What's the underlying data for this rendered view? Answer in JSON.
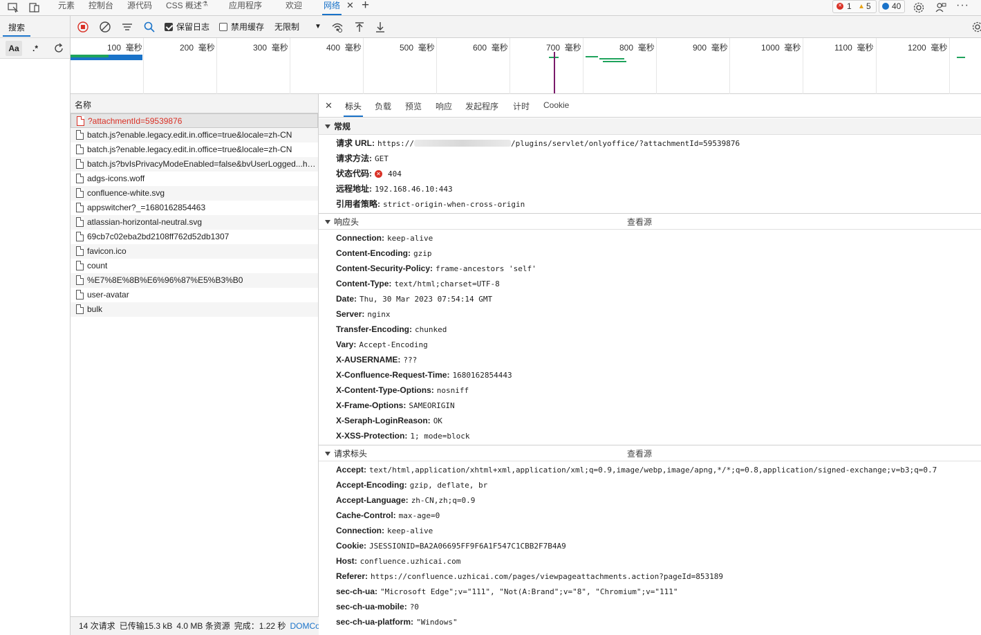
{
  "topbar": {
    "tabs": [
      "元素",
      "控制台",
      "源代码",
      "CSS 概述",
      "应用程序",
      "欢迎",
      "网络"
    ],
    "active_tab": "网络",
    "errors": "1",
    "warnings": "5",
    "messages": "40"
  },
  "left_pane": {
    "search_tab": "搜索",
    "match_case": "Aa",
    "regex": ".*"
  },
  "toolbar": {
    "preserve_log": "保留日志",
    "disable_cache": "禁用缓存",
    "throttle": "无限制"
  },
  "overview": {
    "unit": "毫秒",
    "ticks": [
      "100",
      "200",
      "300",
      "400",
      "500",
      "600",
      "700",
      "800",
      "900",
      "1000",
      "1100",
      "1200"
    ]
  },
  "request_list": {
    "header": "名称",
    "rows": [
      "?attachmentId=59539876",
      "batch.js?enable.legacy.edit.in.office=true&locale=zh-CN",
      "batch.js?enable.legacy.edit.in.office=true&locale=zh-CN",
      "batch.js?bvIsPrivacyModeEnabled=false&bvUserLogged...ho...",
      "adgs-icons.woff",
      "confluence-white.svg",
      "appswitcher?_=1680162854463",
      "atlassian-horizontal-neutral.svg",
      "69cb7c02eba2bd2108ff762d52db1307",
      "favicon.ico",
      "count",
      "%E7%8E%8B%E6%96%87%E5%B3%B0",
      "user-avatar",
      "bulk"
    ]
  },
  "status_bar": {
    "requests": "14 次请求",
    "transferred": "已传输15.3 kB",
    "resources": "4.0 MB 条资源",
    "finish": "完成：1.22 秒",
    "domcontent": "DOMCo"
  },
  "details": {
    "tabs": [
      "标头",
      "负载",
      "预览",
      "响应",
      "发起程序",
      "计时",
      "Cookie"
    ],
    "active_tab": "标头",
    "view_source": "查看源",
    "general": {
      "title": "常规",
      "url_label": "请求 URL:",
      "url_prefix": "https://",
      "url_suffix": "/plugins/servlet/onlyoffice/?attachmentId=59539876",
      "method_label": "请求方法:",
      "method": "GET",
      "status_label": "状态代码:",
      "status": "404",
      "remote_label": "远程地址:",
      "remote": "192.168.46.10:443",
      "referrer_label": "引用者策略:",
      "referrer": "strict-origin-when-cross-origin"
    },
    "response_headers": {
      "title": "响应头",
      "items": [
        {
          "k": "Connection:",
          "v": "keep-alive"
        },
        {
          "k": "Content-Encoding:",
          "v": "gzip"
        },
        {
          "k": "Content-Security-Policy:",
          "v": "frame-ancestors 'self'"
        },
        {
          "k": "Content-Type:",
          "v": "text/html;charset=UTF-8"
        },
        {
          "k": "Date:",
          "v": "Thu, 30 Mar 2023 07:54:14 GMT"
        },
        {
          "k": "Server:",
          "v": "nginx"
        },
        {
          "k": "Transfer-Encoding:",
          "v": "chunked"
        },
        {
          "k": "Vary:",
          "v": "Accept-Encoding"
        },
        {
          "k": "X-AUSERNAME:",
          "v": "???"
        },
        {
          "k": "X-Confluence-Request-Time:",
          "v": "1680162854443"
        },
        {
          "k": "X-Content-Type-Options:",
          "v": "nosniff"
        },
        {
          "k": "X-Frame-Options:",
          "v": "SAMEORIGIN"
        },
        {
          "k": "X-Seraph-LoginReason:",
          "v": "OK"
        },
        {
          "k": "X-XSS-Protection:",
          "v": "1; mode=block"
        }
      ]
    },
    "request_headers": {
      "title": "请求标头",
      "items": [
        {
          "k": "Accept:",
          "v": "text/html,application/xhtml+xml,application/xml;q=0.9,image/webp,image/apng,*/*;q=0.8,application/signed-exchange;v=b3;q=0.7"
        },
        {
          "k": "Accept-Encoding:",
          "v": "gzip, deflate, br"
        },
        {
          "k": "Accept-Language:",
          "v": "zh-CN,zh;q=0.9"
        },
        {
          "k": "Cache-Control:",
          "v": "max-age=0"
        },
        {
          "k": "Connection:",
          "v": "keep-alive"
        },
        {
          "k": "Cookie:",
          "v": "JSESSIONID=BA2A06695FF9F6A1F547C1CBB2F7B4A9"
        },
        {
          "k": "Host:",
          "v": "confluence.uzhicai.com"
        },
        {
          "k": "Referer:",
          "v": "https://confluence.uzhicai.com/pages/viewpageattachments.action?pageId=853189"
        },
        {
          "k": "sec-ch-ua:",
          "v": "\"Microsoft Edge\";v=\"111\", \"Not(A:Brand\";v=\"8\", \"Chromium\";v=\"111\""
        },
        {
          "k": "sec-ch-ua-mobile:",
          "v": "?0"
        },
        {
          "k": "sec-ch-ua-platform:",
          "v": "\"Windows\""
        }
      ]
    }
  }
}
